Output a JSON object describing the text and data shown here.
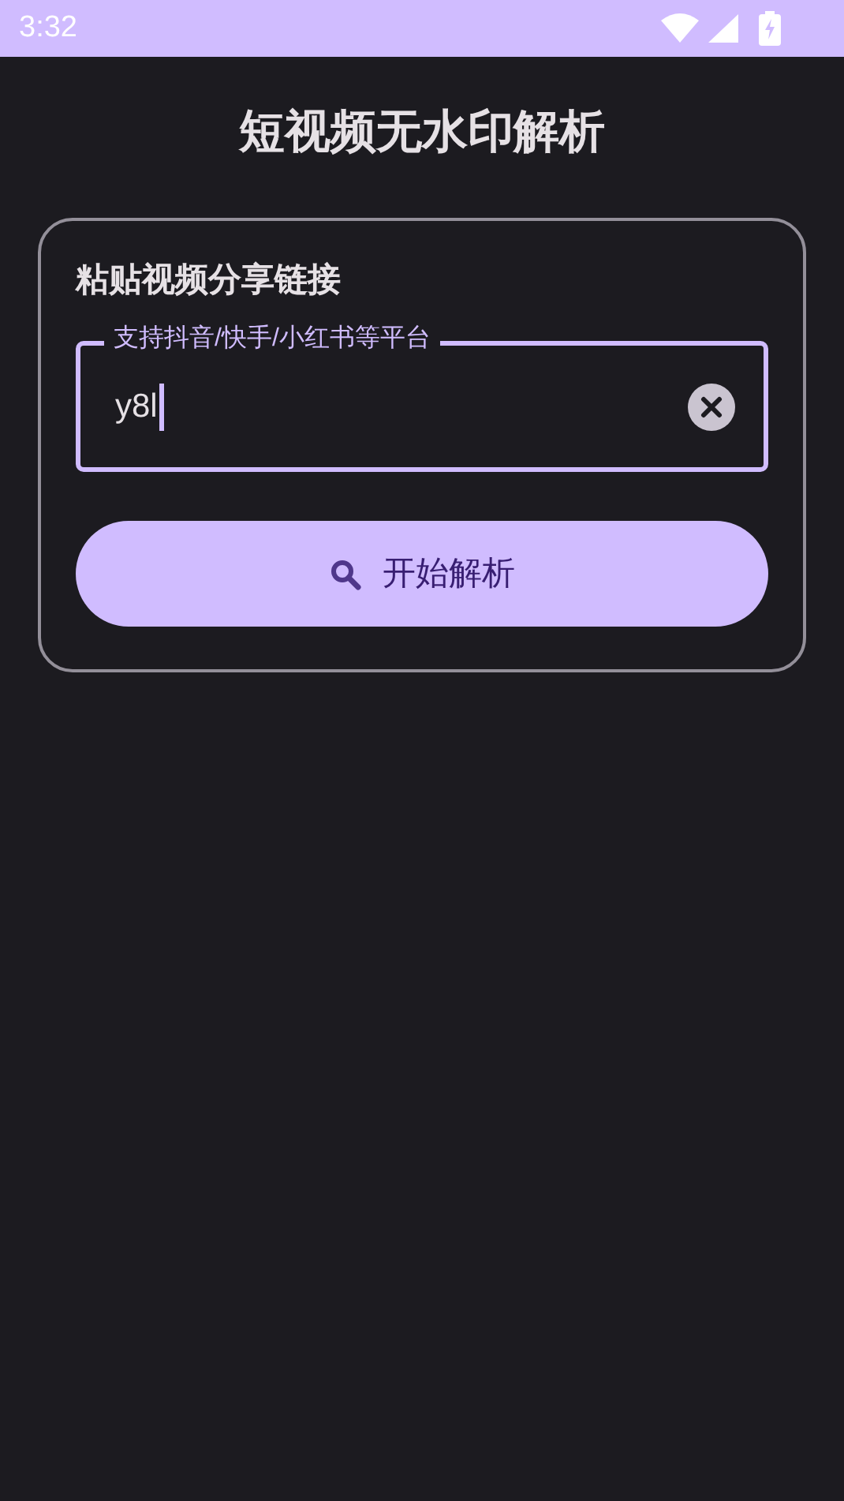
{
  "status_bar": {
    "time": "3:32"
  },
  "title": "短视频无水印解析",
  "card": {
    "heading": "粘贴视频分享链接",
    "field": {
      "label": "支持抖音/快手/小红书等平台",
      "value": "y8l",
      "focused": true
    },
    "button": "开始解析"
  }
}
